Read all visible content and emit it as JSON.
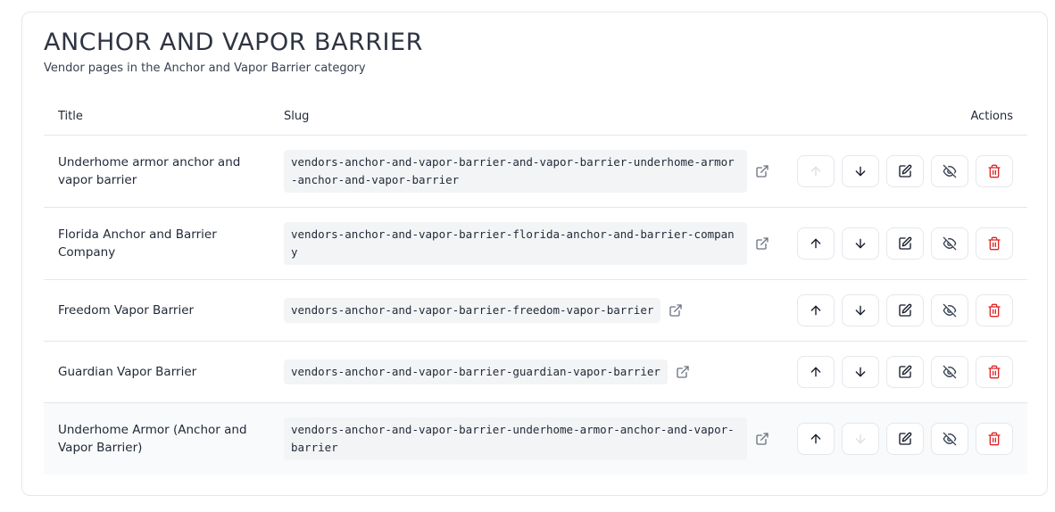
{
  "header": {
    "title": "ANCHOR AND VAPOR BARRIER",
    "subtitle": "Vendor pages in the Anchor and Vapor Barrier category"
  },
  "table": {
    "columns": {
      "title": "Title",
      "slug": "Slug",
      "actions": "Actions"
    },
    "rows": [
      {
        "title": "Underhome armor anchor and vapor barrier",
        "slug": "vendors-anchor-and-vapor-barrier-and-vapor-barrier-underhome-armor-anchor-and-vapor-barrier"
      },
      {
        "title": "Florida Anchor and Barrier Company",
        "slug": "vendors-anchor-and-vapor-barrier-florida-anchor-and-barrier-company"
      },
      {
        "title": "Freedom Vapor Barrier",
        "slug": "vendors-anchor-and-vapor-barrier-freedom-vapor-barrier"
      },
      {
        "title": "Guardian Vapor Barrier",
        "slug": "vendors-anchor-and-vapor-barrier-guardian-vapor-barrier"
      },
      {
        "title": "Underhome Armor (Anchor and Vapor Barrier)",
        "slug": "vendors-anchor-and-vapor-barrier-underhome-armor-anchor-and-vapor-barrier"
      }
    ]
  },
  "icons": {
    "external_link": "external-link-icon",
    "move_up": "arrow-up-icon",
    "move_down": "arrow-down-icon",
    "edit": "edit-icon",
    "hide": "eye-off-icon",
    "delete": "trash-icon"
  },
  "colors": {
    "danger": "#dc2626",
    "slug_bg": "#f3f4f6",
    "border": "#e5e7eb"
  }
}
